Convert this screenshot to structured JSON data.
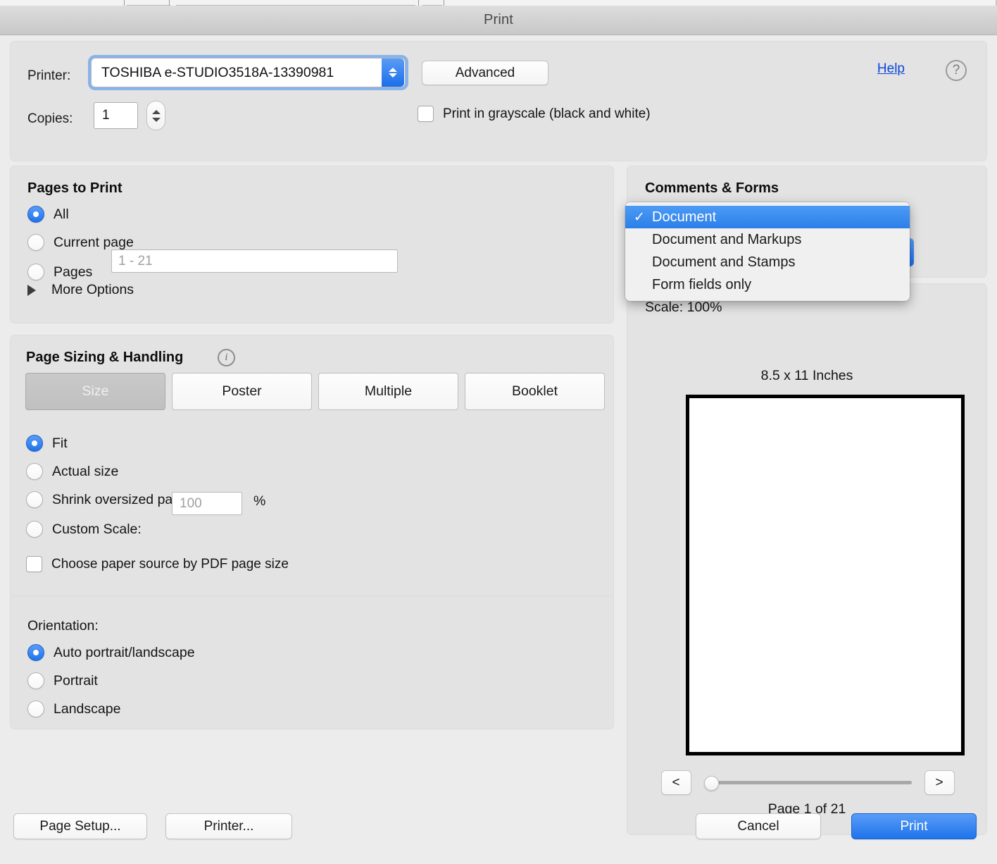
{
  "window": {
    "title": "Print"
  },
  "top": {
    "printer_label": "Printer:",
    "printer_value": "TOSHIBA e-STUDIO3518A-13390981",
    "advanced_label": "Advanced",
    "help_label": "Help",
    "help_icon": "question-mark",
    "copies_label": "Copies:",
    "copies_value": "1",
    "grayscale_label": "Print in grayscale (black and white)",
    "grayscale_checked": false
  },
  "pages_to_print": {
    "title": "Pages to Print",
    "options": [
      {
        "label": "All",
        "selected": true
      },
      {
        "label": "Current page",
        "selected": false
      },
      {
        "label": "Pages",
        "selected": false
      }
    ],
    "pages_placeholder": "1 - 21",
    "more_options_label": "More Options"
  },
  "page_sizing": {
    "title": "Page Sizing & Handling",
    "info_icon": "info-icon",
    "modes": [
      {
        "label": "Size",
        "active": true
      },
      {
        "label": "Poster",
        "active": false
      },
      {
        "label": "Multiple",
        "active": false
      },
      {
        "label": "Booklet",
        "active": false
      }
    ],
    "options": [
      {
        "label": "Fit",
        "selected": true
      },
      {
        "label": "Actual size",
        "selected": false
      },
      {
        "label": "Shrink oversized pages",
        "selected": false
      },
      {
        "label": "Custom Scale:",
        "selected": false
      }
    ],
    "custom_scale_placeholder": "100",
    "percent_sign": "%",
    "paper_source_label": "Choose paper source by PDF page size",
    "paper_source_checked": false
  },
  "orientation": {
    "title": "Orientation:",
    "options": [
      {
        "label": "Auto portrait/landscape",
        "selected": true
      },
      {
        "label": "Portrait",
        "selected": false
      },
      {
        "label": "Landscape",
        "selected": false
      }
    ]
  },
  "comments_forms": {
    "title": "Comments & Forms",
    "selected_value": "Document",
    "menu_open": true,
    "menu_items": [
      {
        "label": "Document",
        "checked": true,
        "selected": true
      },
      {
        "label": "Document and Markups",
        "checked": false,
        "selected": false
      },
      {
        "label": "Document and Stamps",
        "checked": false,
        "selected": false
      },
      {
        "label": "Form fields only",
        "checked": false,
        "selected": false
      }
    ],
    "check_glyph": "✓"
  },
  "preview": {
    "scale_text": "Scale: 100%",
    "paper_size_text": "8.5 x 11 Inches",
    "prev_label": "<",
    "next_label": ">",
    "page_count_text": "Page 1 of 21",
    "slider_position_pct": 0
  },
  "footer": {
    "page_setup_label": "Page Setup...",
    "printer_label": "Printer...",
    "cancel_label": "Cancel",
    "print_label": "Print"
  },
  "colors": {
    "accent_blue": "#2b7fe8",
    "window_bg": "#ececec",
    "group_bg": "#e3e3e3",
    "link_blue": "#0b48d8"
  }
}
